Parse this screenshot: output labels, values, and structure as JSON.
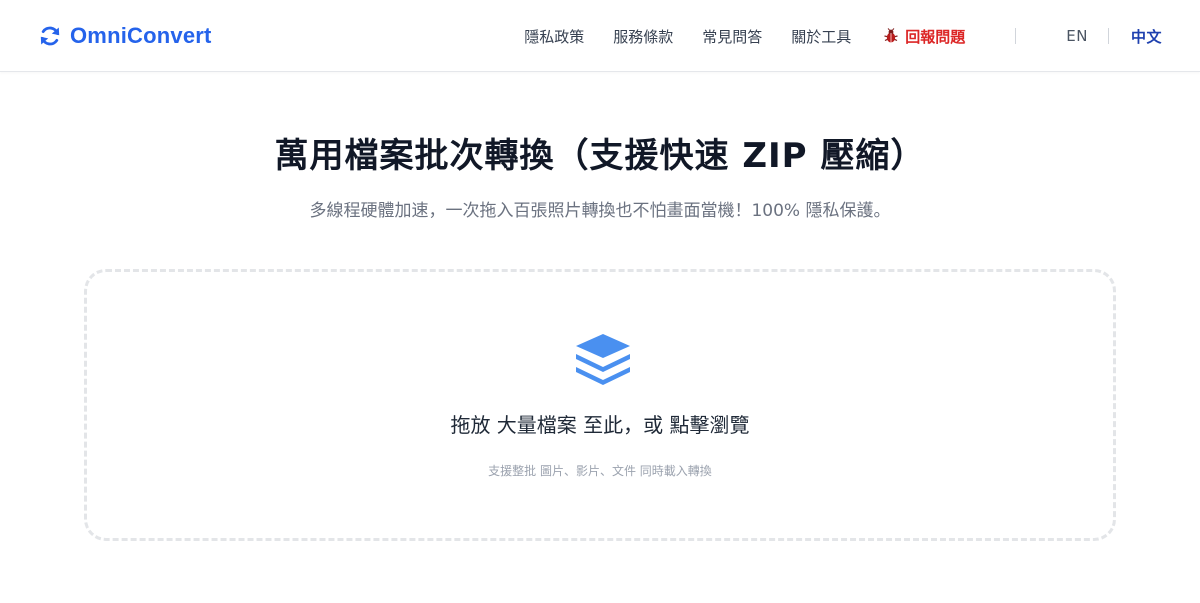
{
  "header": {
    "brand": "OmniConvert",
    "nav": [
      {
        "label": "隱私政策"
      },
      {
        "label": "服務條款"
      },
      {
        "label": "常見問答"
      },
      {
        "label": "關於工具"
      }
    ],
    "report_label": "回報問題",
    "languages": {
      "en": "EN",
      "zh": "中文",
      "active": "zh"
    }
  },
  "hero": {
    "title": "萬用檔案批次轉換（支援快速 ZIP 壓縮）",
    "subtitle": "多線程硬體加速，一次拖入百張照片轉換也不怕畫面當機！100% 隱私保護。"
  },
  "dropzone": {
    "main_text": "拖放 大量檔案 至此，或 點擊瀏覽",
    "hint": "支援整批 圖片、影片、文件 同時載入轉換",
    "icon": "layers-icon"
  },
  "colors": {
    "brand": "#2563eb",
    "report": "#dc2626",
    "active_lang": "#1e40af",
    "icon": "#4a90f0"
  }
}
